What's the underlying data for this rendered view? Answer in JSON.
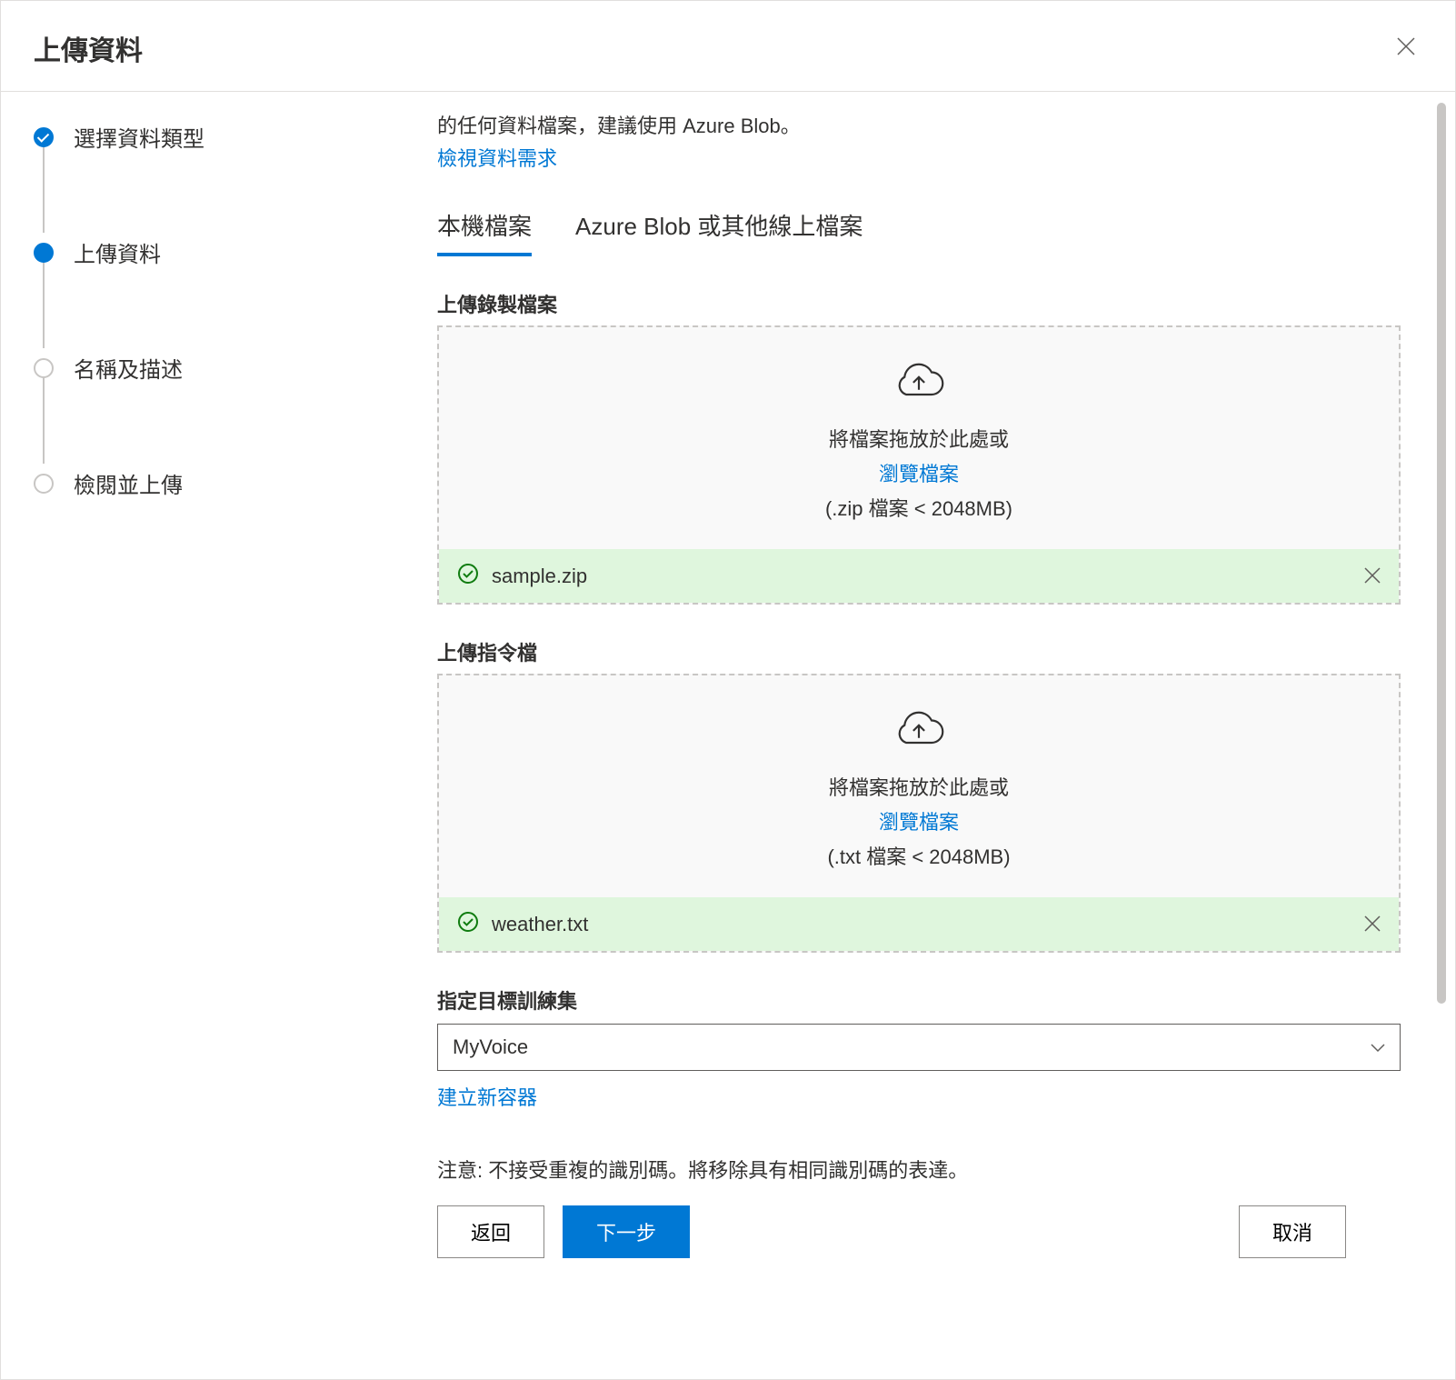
{
  "header": {
    "title": "上傳資料"
  },
  "steps": [
    {
      "label": "選擇資料類型",
      "status": "done"
    },
    {
      "label": "上傳資料",
      "status": "active"
    },
    {
      "label": "名稱及描述",
      "status": "pending"
    },
    {
      "label": "檢閱並上傳",
      "status": "pending"
    }
  ],
  "intro": {
    "text": "的任何資料檔案，建議使用 Azure Blob。",
    "link": "檢視資料需求"
  },
  "tabs": [
    {
      "label": "本機檔案",
      "active": true
    },
    {
      "label": "Azure Blob 或其他線上檔案",
      "active": false
    }
  ],
  "upload_recording": {
    "label": "上傳錄製檔案",
    "drag_text": "將檔案拖放於此處或",
    "browse": "瀏覽檔案",
    "hint": "(.zip 檔案 < 2048MB)",
    "file": "sample.zip"
  },
  "upload_script": {
    "label": "上傳指令檔",
    "drag_text": "將檔案拖放於此處或",
    "browse": "瀏覽檔案",
    "hint": "(.txt 檔案 < 2048MB)",
    "file": "weather.txt"
  },
  "target": {
    "label": "指定目標訓練集",
    "selected": "MyVoice",
    "create": "建立新容器"
  },
  "note": "注意: 不接受重複的識別碼。將移除具有相同識別碼的表達。",
  "footer": {
    "back": "返回",
    "next": "下一步",
    "cancel": "取消"
  }
}
